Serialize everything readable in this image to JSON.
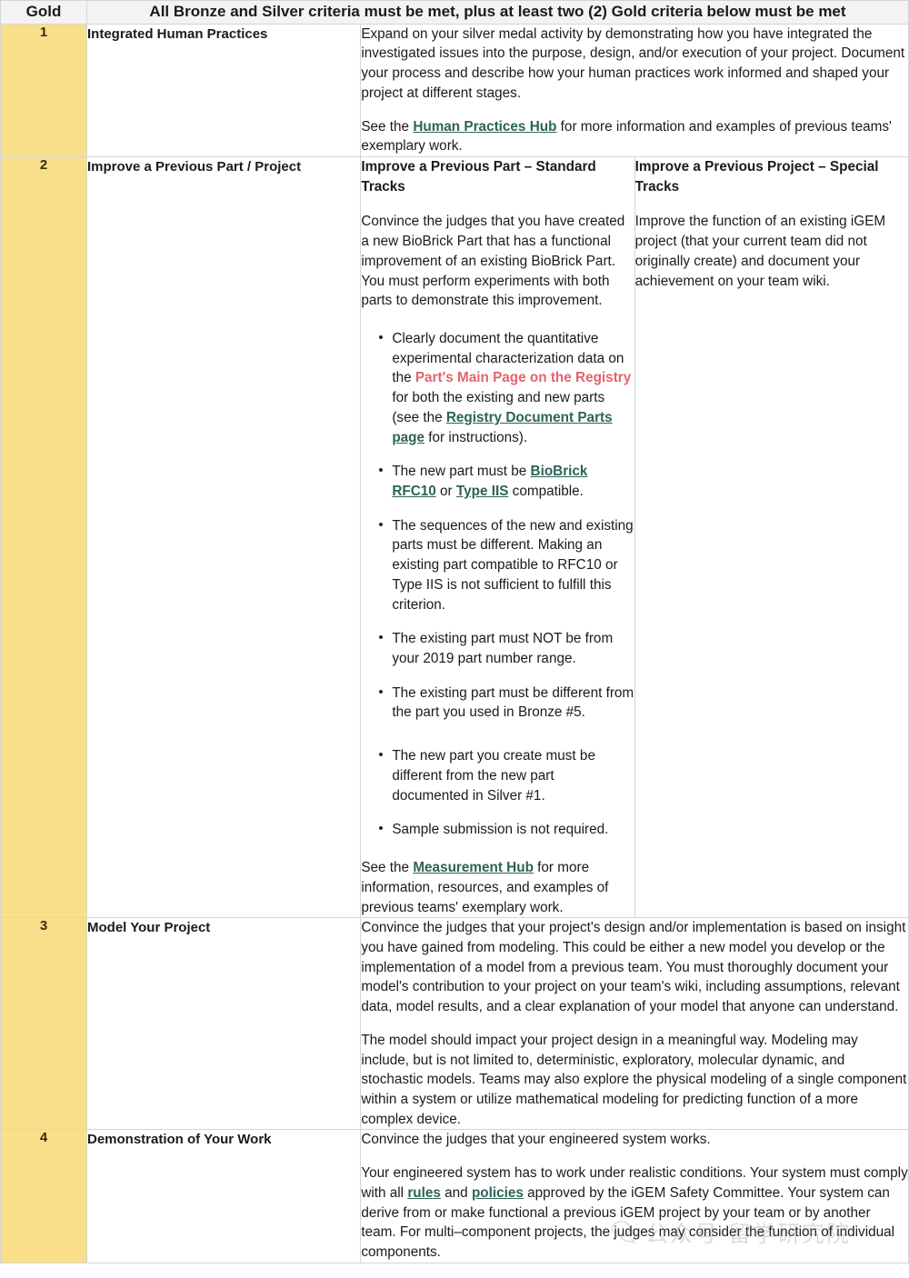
{
  "header": {
    "label": "Gold",
    "text": "All Bronze and Silver criteria must be met, plus at least two (2) Gold criteria below must be met"
  },
  "rows": [
    {
      "number": "1",
      "name": "Integrated Human Practices",
      "paragraphs": {
        "p1": "Expand on your silver medal activity by demonstrating how you have integrated the investigated issues into the purpose, design, and/or execution of your project. Document your process and describe how your human practices work informed and shaped your project at different stages.",
        "p2_before": "See the ",
        "p2_link": "Human Practices Hub",
        "p2_after": " for more information and examples of previous teams' exemplary work."
      }
    },
    {
      "number": "2",
      "name": "Improve a Previous Part / Project",
      "left": {
        "subhead": "Improve a Previous Part – Standard Tracks",
        "intro": "Convince the judges that you have created a new BioBrick Part that has a functional improvement of an existing BioBrick Part. You must perform experiments with both parts to demonstrate this improvement.",
        "bullets": {
          "b1_a": "Clearly document the quantitative experimental characterization data on the ",
          "b1_link_red": "Part's Main Page on the Registry",
          "b1_b": " for both the existing and new parts (see the ",
          "b1_link_green": "Registry Document Parts page",
          "b1_c": " for instructions).",
          "b2_a": "The new part must be ",
          "b2_link1": "BioBrick RFC10",
          "b2_b": " or ",
          "b2_link2": "Type IIS",
          "b2_c": " compatible.",
          "b3": "The sequences of the new and existing parts must be different. Making an existing part compatible to RFC10 or Type IIS is not sufficient to fulfill this criterion.",
          "b4": "The existing part must NOT be from your 2019 part number range.",
          "b5": "The existing part must be different from the part you used in Bronze #5.",
          "b6": "The new part you create must be different from the new part documented in Silver #1.",
          "b7": "Sample submission is not required."
        },
        "closing_before": "See the ",
        "closing_link": "Measurement Hub",
        "closing_after": " for more information, resources, and examples of previous teams' exemplary work."
      },
      "right": {
        "subhead": "Improve a Previous Project – Special Tracks",
        "text": "Improve the function of an existing iGEM project (that your current team did not originally create) and document your achievement on your team wiki."
      }
    },
    {
      "number": "3",
      "name": "Model Your Project",
      "paragraphs": {
        "p1": "Convince the judges that your project's design and/or implementation is based on insight you have gained from modeling. This could be either a new model you develop or the implementation of a model from a previous team. You must thoroughly document your model's contribution to your project on your team's wiki, including assumptions, relevant data, model results, and a clear explanation of your model that anyone can understand.",
        "p2": "The model should impact your project design in a meaningful way. Modeling may include, but is not limited to, deterministic, exploratory, molecular dynamic, and stochastic models. Teams may also explore the physical modeling of a single component within a system or utilize mathematical modeling for predicting function of a more complex device."
      }
    },
    {
      "number": "4",
      "name": "Demonstration of Your Work",
      "paragraphs": {
        "p1": "Convince the judges that your engineered system works.",
        "p2_a": "Your engineered system has to work under realistic conditions. Your system must comply with all ",
        "p2_link1": "rules",
        "p2_b": " and ",
        "p2_link2": "policies",
        "p2_c": " approved by the iGEM Safety Committee. Your system can derive from or make functional a previous iGEM project by your team or by another team. For multi–component projects, the judges may consider the function of individual components."
      }
    }
  ],
  "watermark": {
    "text": "公众号 留学研究院",
    "icon": "chat-bubble-icon"
  },
  "colors": {
    "gold_cell": "#fadf8a",
    "header_bg": "#f3f3f3",
    "link_green": "#2d6357",
    "link_red": "#e2636d",
    "border": "#d5d5d5"
  }
}
